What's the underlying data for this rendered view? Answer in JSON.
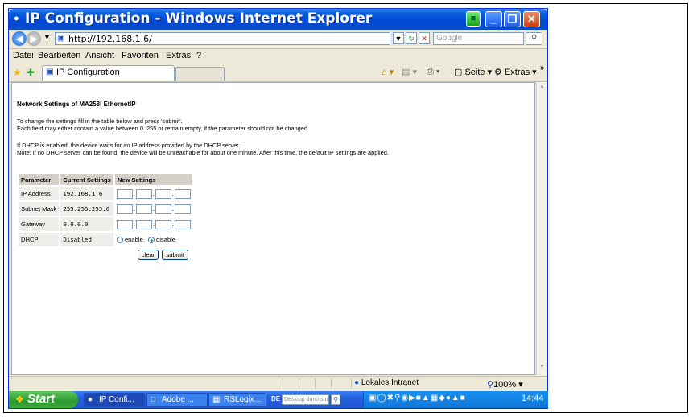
{
  "window": {
    "title": "IP Configuration - Windows Internet Explorer"
  },
  "address_bar": {
    "url": "http://192.168.1.6/",
    "search_placeholder": "Google"
  },
  "menu": [
    "Datei",
    "Bearbeiten",
    "Ansicht",
    "Favoriten",
    "Extras",
    "?"
  ],
  "tab": {
    "label": "IP Configuration"
  },
  "command_bar": {
    "page_label": "Seite",
    "tools_label": "Extras"
  },
  "page": {
    "heading": "Network Settings of MA258i EthernetIP",
    "intro_line1": "To change the settings fill in the table below and press 'submit'.",
    "intro_line2": "Each field may either contain a value between 0..255 or remain empty, if the parameter should not be changed.",
    "dhcp_line1": "If DHCP is enabled, the device waits for an IP address provided by the DHCP server.",
    "dhcp_line2": "Note: If no DHCP server can be found, the device will be unreachable for about one minute. After this time, the default IP settings are applied.",
    "table": {
      "headers": [
        "Parameter",
        "Current Settings",
        "New Settings"
      ],
      "rows": [
        {
          "parameter": "IP Address",
          "current": "192.168.1.6"
        },
        {
          "parameter": "Subnet Mask",
          "current": "255.255.255.0"
        },
        {
          "parameter": "Gateway",
          "current": "0.0.0.0"
        },
        {
          "parameter": "DHCP",
          "current": "Disabled"
        }
      ],
      "dhcp_options": {
        "enable": "enable",
        "disable": "disable",
        "selected": "disable"
      }
    },
    "buttons": {
      "clear": "clear",
      "submit": "submit"
    }
  },
  "status_bar": {
    "zone": "Lokales Intranet",
    "zoom": "100%"
  },
  "taskbar": {
    "start": "Start",
    "tasks": [
      "IP Confi...",
      "Adobe ...",
      "RSLogix..."
    ],
    "language": "DE",
    "desktop_search": "Desktop durchsuchen",
    "clock": "14:44"
  }
}
